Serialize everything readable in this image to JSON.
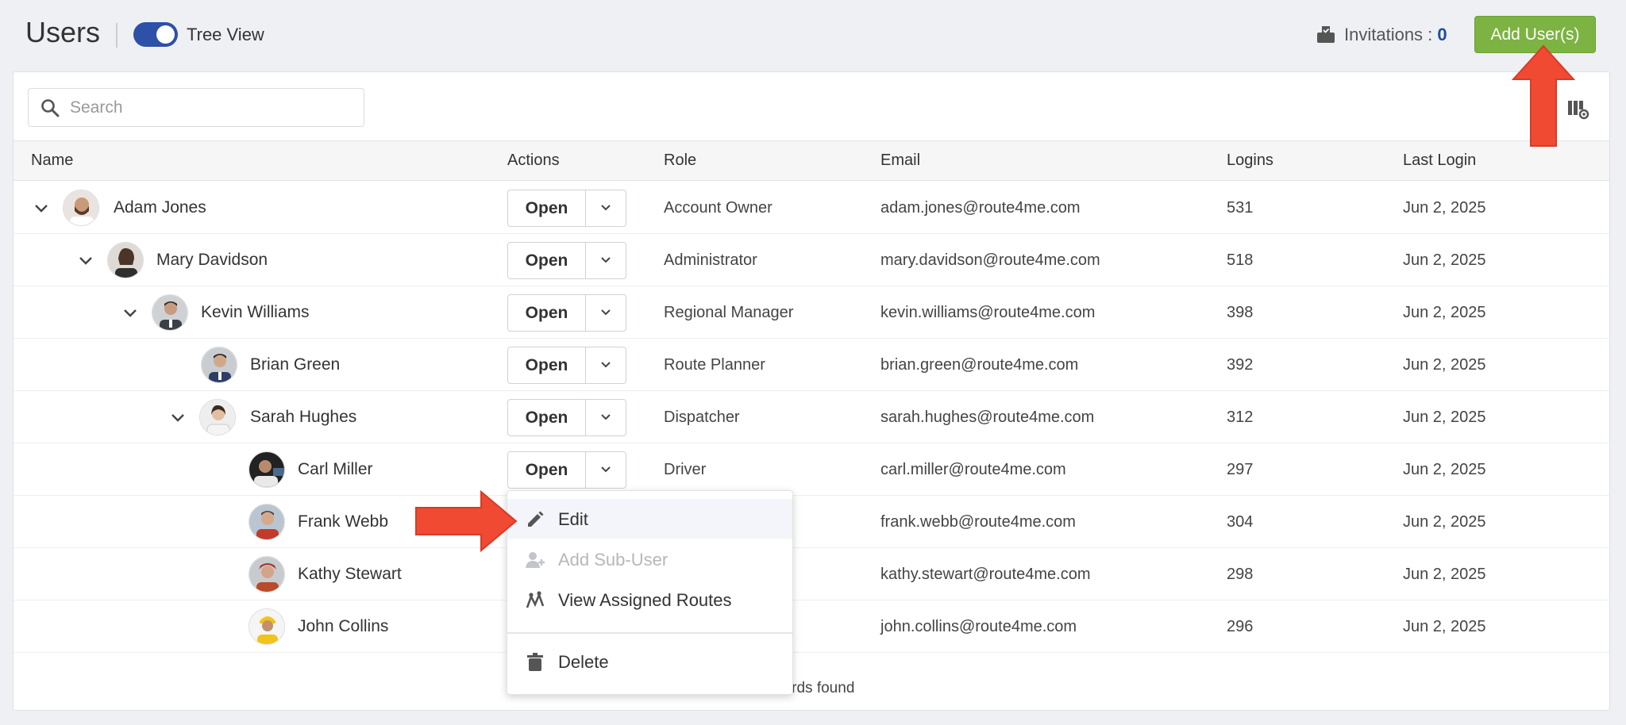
{
  "header": {
    "title": "Users",
    "toggle_label": "Tree View",
    "toggle_on": true,
    "invitations_label": "Invitations :",
    "invitations_count": "0",
    "add_button": "Add User(s)"
  },
  "search": {
    "placeholder": "Search",
    "value": ""
  },
  "table": {
    "columns": [
      "Name",
      "Actions",
      "Role",
      "Email",
      "Logins",
      "Last Login"
    ],
    "open_label": "Open",
    "rows": [
      {
        "name": "Adam Jones",
        "role": "Account Owner",
        "email": "adam.jones@route4me.com",
        "logins": "531",
        "last_login": "Jun 2, 2025"
      },
      {
        "name": "Mary Davidson",
        "role": "Administrator",
        "email": "mary.davidson@route4me.com",
        "logins": "518",
        "last_login": "Jun 2, 2025"
      },
      {
        "name": "Kevin Williams",
        "role": "Regional Manager",
        "email": "kevin.williams@route4me.com",
        "logins": "398",
        "last_login": "Jun 2, 2025"
      },
      {
        "name": "Brian Green",
        "role": "Route Planner",
        "email": "brian.green@route4me.com",
        "logins": "392",
        "last_login": "Jun 2, 2025"
      },
      {
        "name": "Sarah Hughes",
        "role": "Dispatcher",
        "email": "sarah.hughes@route4me.com",
        "logins": "312",
        "last_login": "Jun 2, 2025"
      },
      {
        "name": "Carl Miller",
        "role": "Driver",
        "email": "carl.miller@route4me.com",
        "logins": "297",
        "last_login": "Jun 2, 2025"
      },
      {
        "name": "Frank Webb",
        "role": "",
        "email": "frank.webb@route4me.com",
        "logins": "304",
        "last_login": "Jun 2, 2025"
      },
      {
        "name": "Kathy Stewart",
        "role": "",
        "email": "kathy.stewart@route4me.com",
        "logins": "298",
        "last_login": "Jun 2, 2025"
      },
      {
        "name": "John Collins",
        "role": "",
        "email": "john.collins@route4me.com",
        "logins": "296",
        "last_login": "Jun 2, 2025"
      }
    ],
    "footer": "…ords found"
  },
  "menu": {
    "items": [
      {
        "label": "Edit",
        "icon": "pencil-icon",
        "disabled": false
      },
      {
        "label": "Add Sub-User",
        "icon": "add-user-icon",
        "disabled": true
      },
      {
        "label": "View Assigned Routes",
        "icon": "routes-icon",
        "disabled": false
      },
      {
        "label": "Delete",
        "icon": "trash-icon",
        "disabled": false
      }
    ]
  },
  "colors": {
    "accent_green": "#7cb342",
    "toggle_blue": "#2d50a8",
    "arrow_red": "#f04a32",
    "invitations_count": "#1b4f9c"
  }
}
